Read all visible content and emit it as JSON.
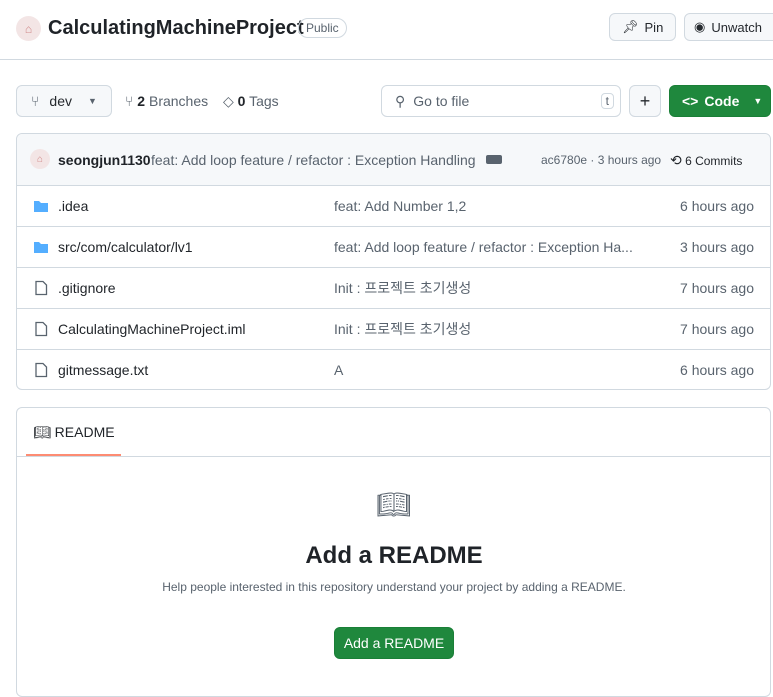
{
  "repo": {
    "name": "CalculatingMachineProject",
    "visibility": "Public"
  },
  "header": {
    "pin": "Pin",
    "unwatch": "Unwatch"
  },
  "toolbar": {
    "branch": "dev",
    "branches_count": "2",
    "branches_label": "Branches",
    "tags_count": "0",
    "tags_label": "Tags",
    "search_placeholder": "Go to file",
    "search_key": "t",
    "add": "+",
    "code": "Code"
  },
  "commit": {
    "author": "seongjun1130",
    "message": "feat: Add loop feature / refactor : Exception Handling",
    "hash": "ac6780e · 3 hours ago",
    "commits": "6 Commits"
  },
  "files": [
    {
      "name": ".idea",
      "type": "folder",
      "message": "feat: Add Number 1,2",
      "time": "6 hours ago"
    },
    {
      "name": "src/com/calculator/lv1",
      "type": "folder",
      "message": "feat: Add loop feature / refactor : Exception Ha...",
      "time": "3 hours ago"
    },
    {
      "name": ".gitignore",
      "type": "file",
      "message": "Init : 프로젝트 초기생성",
      "time": "7 hours ago"
    },
    {
      "name": "CalculatingMachineProject.iml",
      "type": "file",
      "message": "Init : 프로젝트 초기생성",
      "time": "7 hours ago"
    },
    {
      "name": "gitmessage.txt",
      "type": "file",
      "message": "A",
      "time": "6 hours ago"
    }
  ],
  "readme": {
    "tab": "README",
    "title": "Add a README",
    "desc": "Help people interested in this repository understand your project by adding a README.",
    "button": "Add a README"
  }
}
